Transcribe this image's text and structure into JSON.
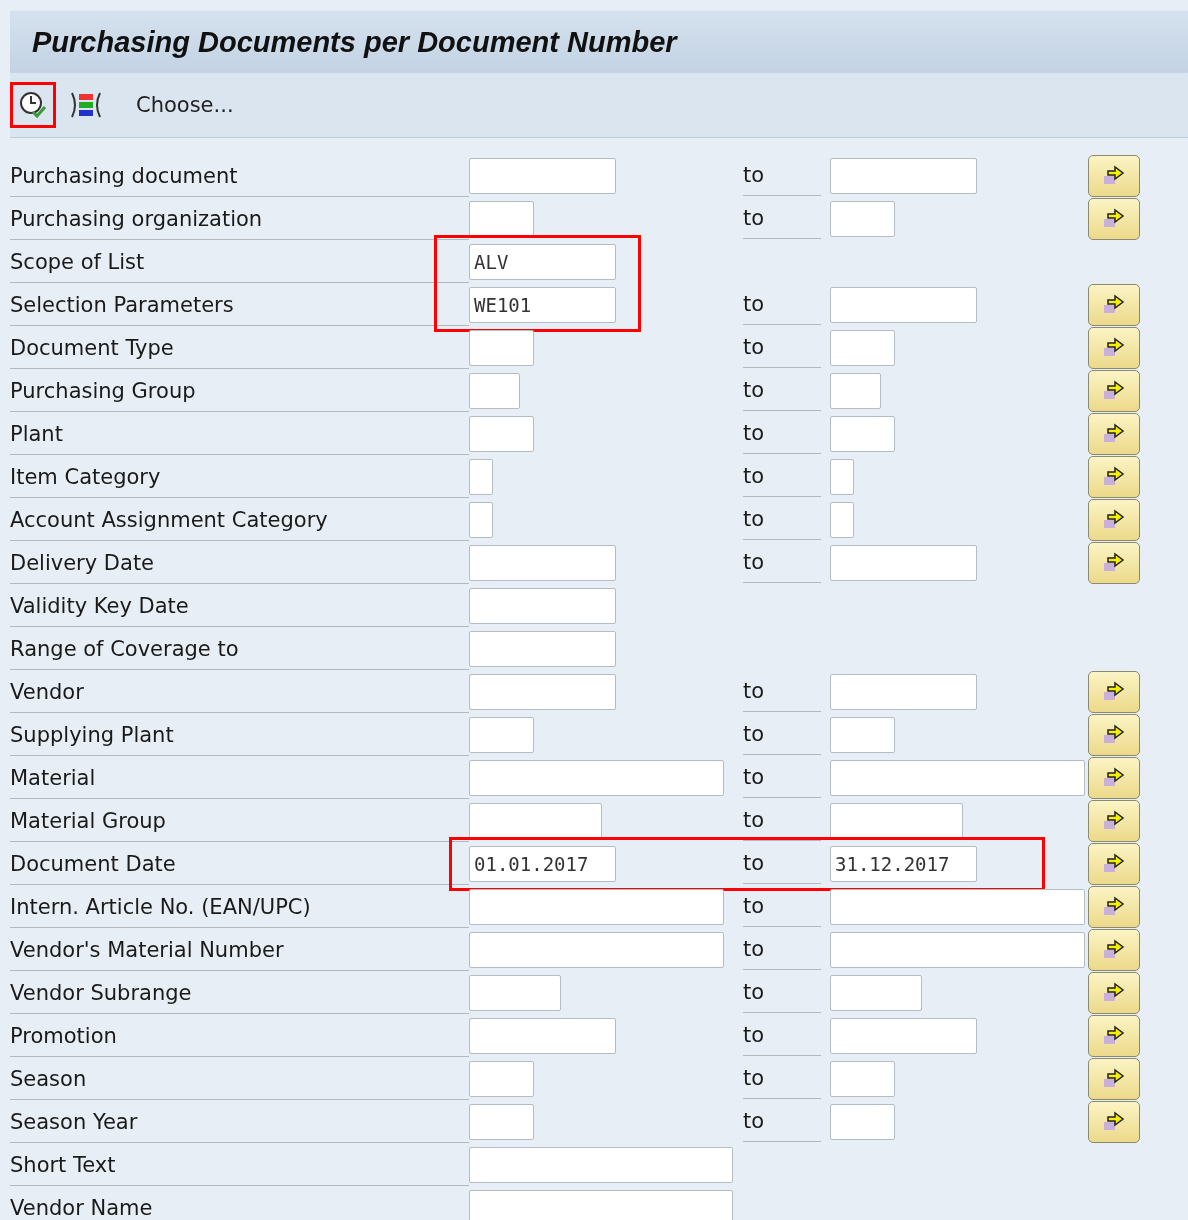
{
  "title": "Purchasing Documents per Document Number",
  "toolbar": {
    "execute_highlighted": true,
    "choose_label": "Choose..."
  },
  "rows": [
    {
      "label": "Purchasing document",
      "low": {
        "kind": "l"
      },
      "to": "to",
      "high": {
        "kind": "l"
      },
      "more": true
    },
    {
      "label": "Purchasing organization",
      "low": {
        "kind": "m"
      },
      "to": "to",
      "high": {
        "kind": "m"
      },
      "more": true
    },
    {
      "label": "Scope of List",
      "low": {
        "kind": "l",
        "value": "ALV",
        "highlighted": true
      },
      "more": false
    },
    {
      "label": "Selection Parameters",
      "low": {
        "kind": "l",
        "value": "WE101",
        "highlighted": true
      },
      "to": "to",
      "high": {
        "kind": "l"
      },
      "more": true
    },
    {
      "label": "Document Type",
      "low": {
        "kind": "m"
      },
      "to": "to",
      "high": {
        "kind": "m"
      },
      "more": true
    },
    {
      "label": "Purchasing Group",
      "low": {
        "kind": "s"
      },
      "to": "to",
      "high": {
        "kind": "s"
      },
      "more": true
    },
    {
      "label": "Plant",
      "low": {
        "kind": "m"
      },
      "to": "to",
      "high": {
        "kind": "m"
      },
      "more": true
    },
    {
      "label": "Item Category",
      "low": {
        "kind": "xs"
      },
      "to": "to",
      "high": {
        "kind": "xs"
      },
      "more": true
    },
    {
      "label": "Account Assignment Category",
      "low": {
        "kind": "xs"
      },
      "to": "to",
      "high": {
        "kind": "xs"
      },
      "more": true
    },
    {
      "label": "Delivery Date",
      "low": {
        "kind": "l"
      },
      "to": "to",
      "high": {
        "kind": "l"
      },
      "more": true
    },
    {
      "label": "Validity Key Date",
      "low": {
        "kind": "l"
      },
      "more": false
    },
    {
      "label": "Range of Coverage to",
      "low": {
        "kind": "l"
      },
      "more": false
    },
    {
      "label": "Vendor",
      "low": {
        "kind": "l"
      },
      "to": "to",
      "high": {
        "kind": "l"
      },
      "more": true
    },
    {
      "label": "Supplying Plant",
      "low": {
        "kind": "m"
      },
      "to": "to",
      "high": {
        "kind": "m"
      },
      "more": true
    },
    {
      "label": "Material",
      "low": {
        "kind": "xl"
      },
      "to": "to",
      "high": {
        "kind": "xl"
      },
      "more": true
    },
    {
      "label": "Material Group",
      "low": {
        "kind": "mg"
      },
      "to": "to",
      "high": {
        "kind": "mg"
      },
      "more": true
    },
    {
      "label": "Document Date",
      "low": {
        "kind": "l",
        "value": "01.01.2017",
        "highlighted": true
      },
      "to": "to",
      "high": {
        "kind": "l",
        "value": "31.12.2017",
        "highlighted": true
      },
      "more": true
    },
    {
      "label": "Intern. Article No. (EAN/UPC)",
      "low": {
        "kind": "xl"
      },
      "to": "to",
      "high": {
        "kind": "xl"
      },
      "more": true
    },
    {
      "label": "Vendor's Material Number",
      "low": {
        "kind": "xl"
      },
      "to": "to",
      "high": {
        "kind": "xl"
      },
      "more": true
    },
    {
      "label": "Vendor Subrange",
      "low": {
        "kind": "ml"
      },
      "to": "to",
      "high": {
        "kind": "ml"
      },
      "more": true
    },
    {
      "label": "Promotion",
      "low": {
        "kind": "l"
      },
      "to": "to",
      "high": {
        "kind": "l"
      },
      "more": true
    },
    {
      "label": "Season",
      "low": {
        "kind": "m"
      },
      "to": "to",
      "high": {
        "kind": "m"
      },
      "more": true
    },
    {
      "label": "Season Year",
      "low": {
        "kind": "m"
      },
      "to": "to",
      "high": {
        "kind": "m"
      },
      "more": true
    },
    {
      "label": "Short Text",
      "low": {
        "kind": "full"
      },
      "more": false
    },
    {
      "label": "Vendor Name",
      "low": {
        "kind": "full"
      },
      "more": false
    }
  ]
}
